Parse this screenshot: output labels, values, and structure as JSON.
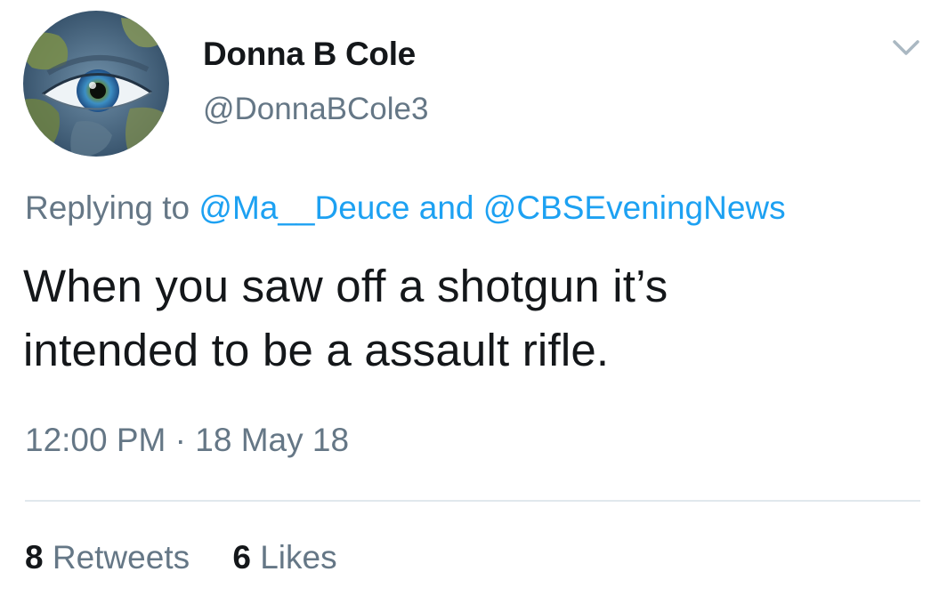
{
  "tweet": {
    "author": {
      "display_name": "Donna B Cole",
      "handle": "@DonnaBCole3",
      "avatar_icon": "earth-eye-avatar"
    },
    "menu_icon": "chevron-down-icon",
    "reply": {
      "prefix": "Replying to",
      "mention_1": "@Ma__Deuce",
      "conjunction": "and",
      "mention_2": "@CBSEveningNews"
    },
    "text_line_1": "When you saw off a shotgun it’s",
    "text_line_2": "intended to be a assault rifle.",
    "time": "12:00 PM",
    "separator": "·",
    "date": "18 May 18",
    "retweets": {
      "count": "8",
      "label": "Retweets"
    },
    "likes": {
      "count": "6",
      "label": "Likes"
    }
  },
  "colors": {
    "text_primary": "#14171a",
    "text_secondary": "#657786",
    "link": "#1da1f2",
    "divider": "#e1e8ed"
  }
}
